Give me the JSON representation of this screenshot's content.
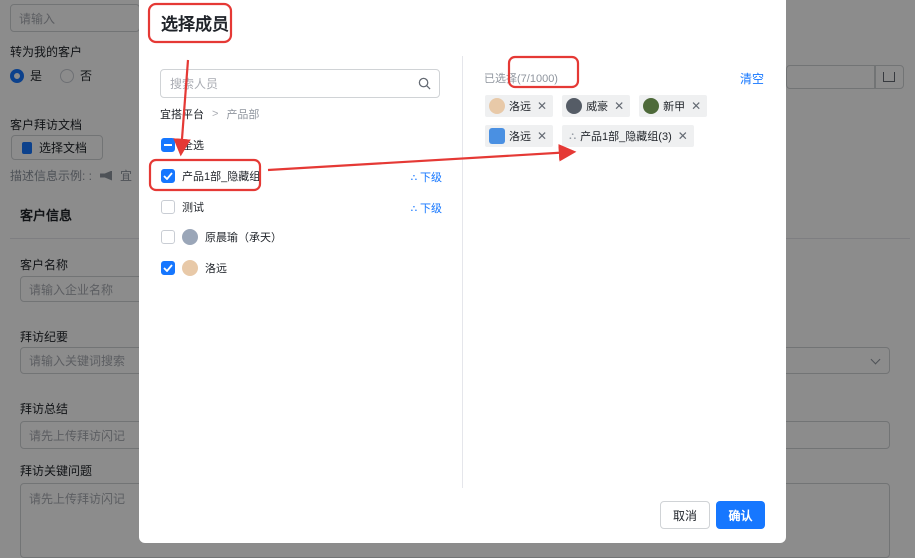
{
  "background_form": {
    "input_placeholder": "请输入",
    "transfer_label": "转为我的客户",
    "radio_yes": "是",
    "radio_no": "否",
    "visit_doc_label": "客户拜访文档",
    "select_doc_button": "选择文档",
    "desc_example": "描述信息示例: :",
    "desc_example_tail": "宜",
    "section_customer_info": "客户信息",
    "customer_name_label": "客户名称",
    "customer_name_placeholder": "请输入企业名称",
    "visit_summary_label": "拜访纪要",
    "visit_summary_placeholder": "请输入关键词搜索",
    "visit_conclusion_label": "拜访总结",
    "visit_conclusion_placeholder": "请先上传拜访闪记",
    "visit_key_issues_label": "拜访关键问题",
    "visit_key_issues_placeholder": "请先上传拜访闪记"
  },
  "dialog": {
    "title": "选择成员",
    "search_placeholder": "搜索人员",
    "breadcrumb": [
      "宜搭平台",
      "产品部"
    ],
    "select_all_label": "全选",
    "tree_items": [
      {
        "label": "产品1部_隐藏组",
        "checked": true,
        "has_sub": true
      },
      {
        "label": "测试",
        "checked": false,
        "has_sub": true
      },
      {
        "label": "原晨瑜（承天）",
        "checked": false,
        "has_sub": false,
        "avatar": true
      },
      {
        "label": "洛远",
        "checked": true,
        "has_sub": false,
        "avatar": true
      }
    ],
    "sub_label": "下级",
    "selected_prefix": "已选择",
    "selected_count": "(7/1000)",
    "clear_label": "清空",
    "selected_tags": [
      "洛远",
      "威豪",
      "新甲",
      "洛远",
      "产品1部_隐藏组(3)"
    ],
    "cancel_label": "取消",
    "confirm_label": "确认"
  },
  "colors": {
    "primary": "#1677ff",
    "annotation_red": "#e53935",
    "overlay": "rgba(0,0,0,0.45)"
  }
}
